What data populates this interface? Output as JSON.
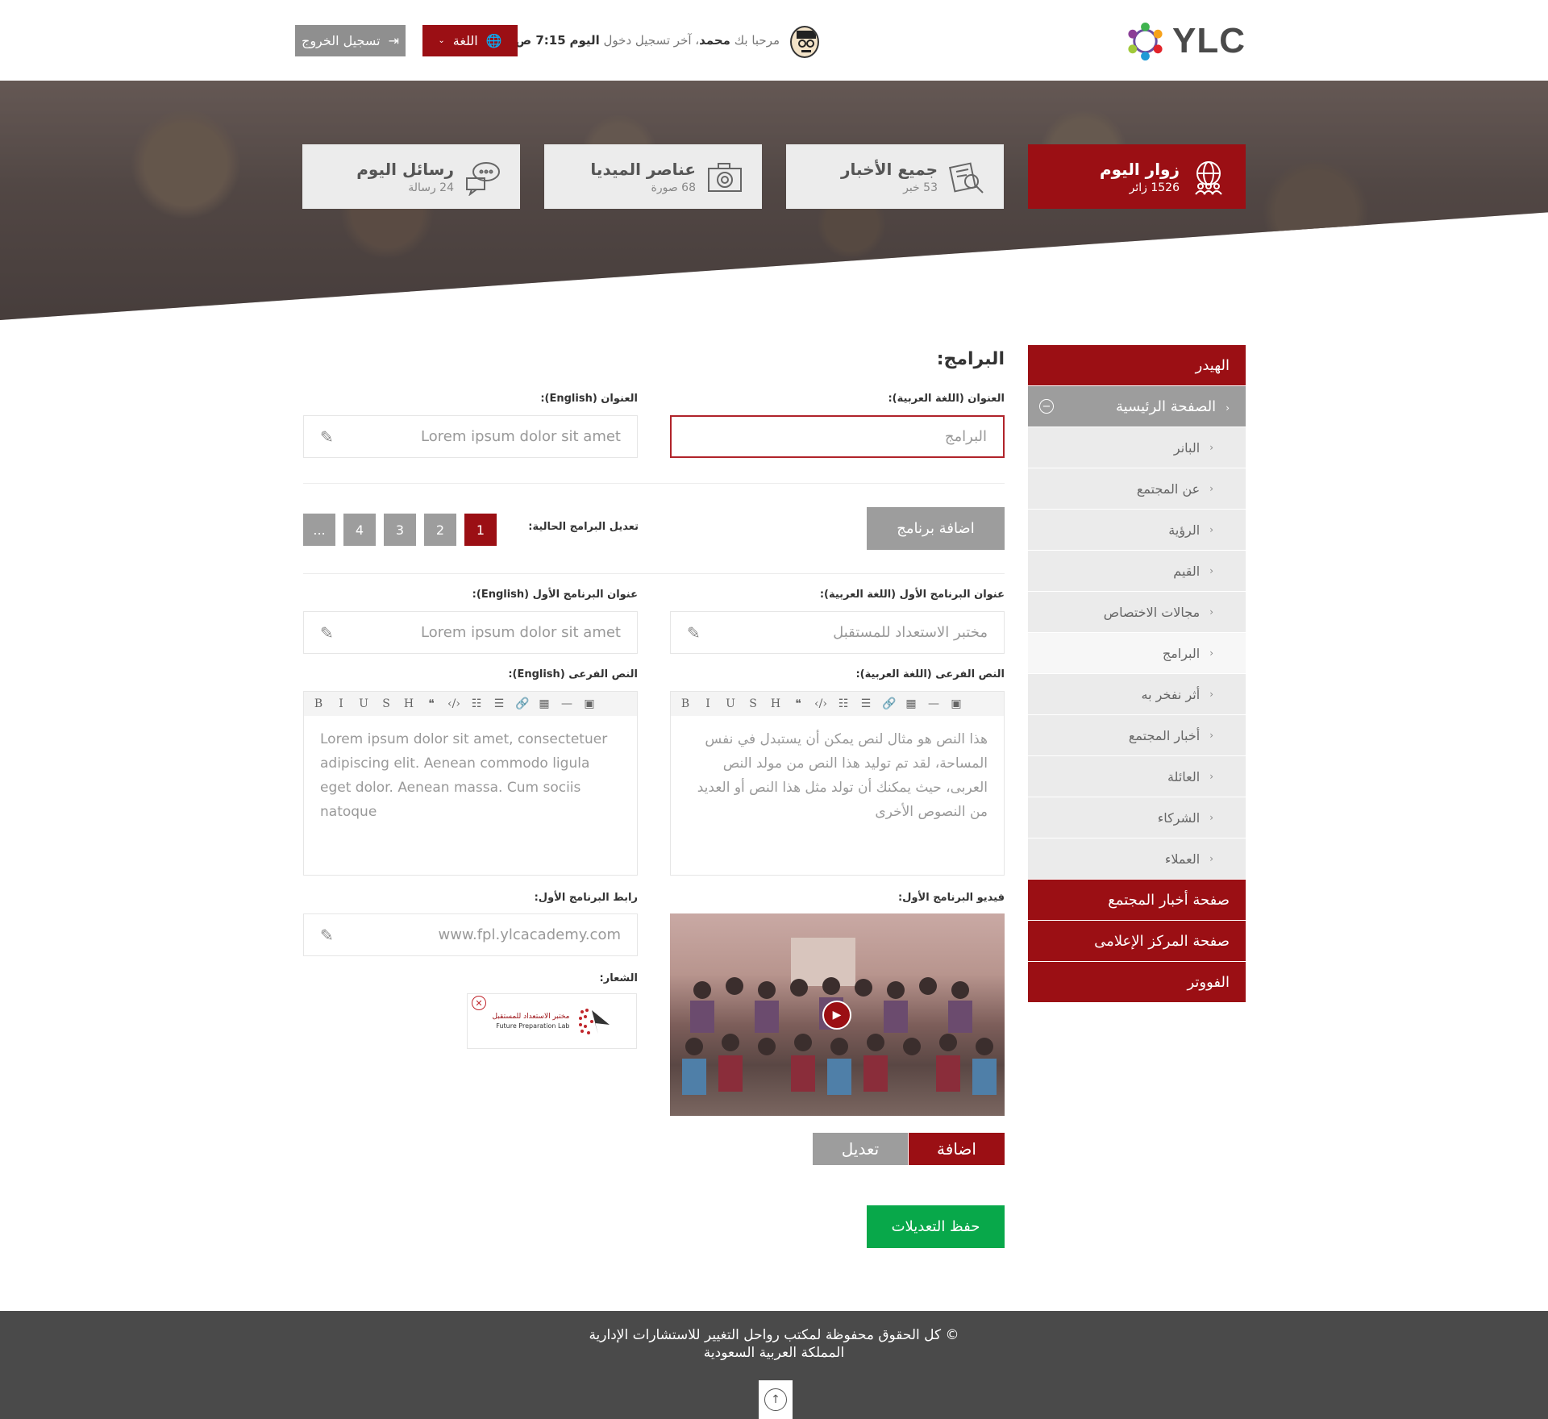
{
  "header": {
    "logo_text": "YLC",
    "welcome_prefix": "مرحبا بك",
    "user_name": "محمد",
    "last_login_label": "، آخر تسجيل دخول",
    "last_login_day": "اليوم",
    "last_login_time": "7:15 ص",
    "language_label": "اللغة",
    "logout_label": "تسجيل الخروج"
  },
  "stats": [
    {
      "title": "زوار اليوم",
      "sub": "1526 زائر",
      "icon": "globe-people-icon",
      "active": true
    },
    {
      "title": "جميع الأخبار",
      "sub": "53 خبر",
      "icon": "news-search-icon",
      "active": false
    },
    {
      "title": "عناصر الميديا",
      "sub": "68 صورة",
      "icon": "camera-icon",
      "active": false
    },
    {
      "title": "رسائل اليوم",
      "sub": "24 رسالة",
      "icon": "chat-bubbles-icon",
      "active": false
    }
  ],
  "sidebar": {
    "header_item": "الهيدر",
    "home_item": "الصفحة الرئيسية",
    "sub_items": [
      "البانر",
      "عن المجتمع",
      "الرؤية",
      "القيم",
      "مجالات الاختصاص",
      "البرامج",
      "أثر نفخر به",
      "أخبار المجتمع",
      "العائلة",
      "الشركاء",
      "العملاء"
    ],
    "active_sub": 5,
    "bottom_items": [
      "صفحة أخبار المجتمع",
      "صفحة المركز الإعلامى",
      "الفووتر"
    ]
  },
  "form": {
    "section_title": "البرامج:",
    "title_ar_label": "العنوان (اللغة العربية):",
    "title_ar_value": "البرامج",
    "title_en_label": "العنوان (English):",
    "title_en_value": "Lorem ipsum dolor sit amet",
    "add_program_label": "اضافة برنامج",
    "edit_current_label": "تعديل البرامج الحالية:",
    "pages": [
      "1",
      "2",
      "3",
      "4",
      "..."
    ],
    "p_title_ar_label": "عنوان البرنامج الأول (اللغة العربية):",
    "p_title_ar_value": "مختبر الاستعداد للمستقبل",
    "p_title_en_label": "عنوان البرنامج الأول (English):",
    "p_title_en_value": "Lorem ipsum dolor sit amet",
    "sub_ar_label": "النص الفرعى (اللغة العربية):",
    "sub_ar_value": "هذا النص هو مثال لنص يمكن أن يستبدل في نفس المساحة، لقد تم توليد هذا النص من مولد النص العربى، حيث يمكنك أن تولد مثل هذا النص أو العديد من النصوص الأخرى",
    "sub_en_label": "النص الفرعى (English):",
    "sub_en_value": "Lorem ipsum dolor sit amet, consectetuer adipiscing elit. Aenean commodo ligula eget dolor. Aenean massa. Cum sociis natoque",
    "toolbar": [
      "B",
      "I",
      "U",
      "S",
      "H",
      "❝",
      "‹/›",
      "☷",
      "☰",
      "🔗",
      "▦",
      "—",
      "▣"
    ],
    "video_label": "فيديو البرنامج الأول:",
    "link_label": "رابط البرنامج الأول:",
    "link_value": "www.fpl.ylcacademy.com",
    "logo_label": "الشعار:",
    "logo_ar": "مختبر الاستعداد للمستقبل",
    "logo_en": "Future Preparation Lab",
    "add_label": "اضافة",
    "edit_label": "تعديل",
    "save_label": "حفظ التعديلات"
  },
  "footer": {
    "line1": "© كل الحقوق محفوظة لمكتب رواحل التغيير للاستشارات الإدارية",
    "line2": "المملكة العربية السعودية"
  },
  "colors": {
    "brand_red": "#9b0f14",
    "gray_button": "#9d9d9d",
    "save_green": "#08a84a",
    "footer_bg": "#4a4a4a"
  }
}
